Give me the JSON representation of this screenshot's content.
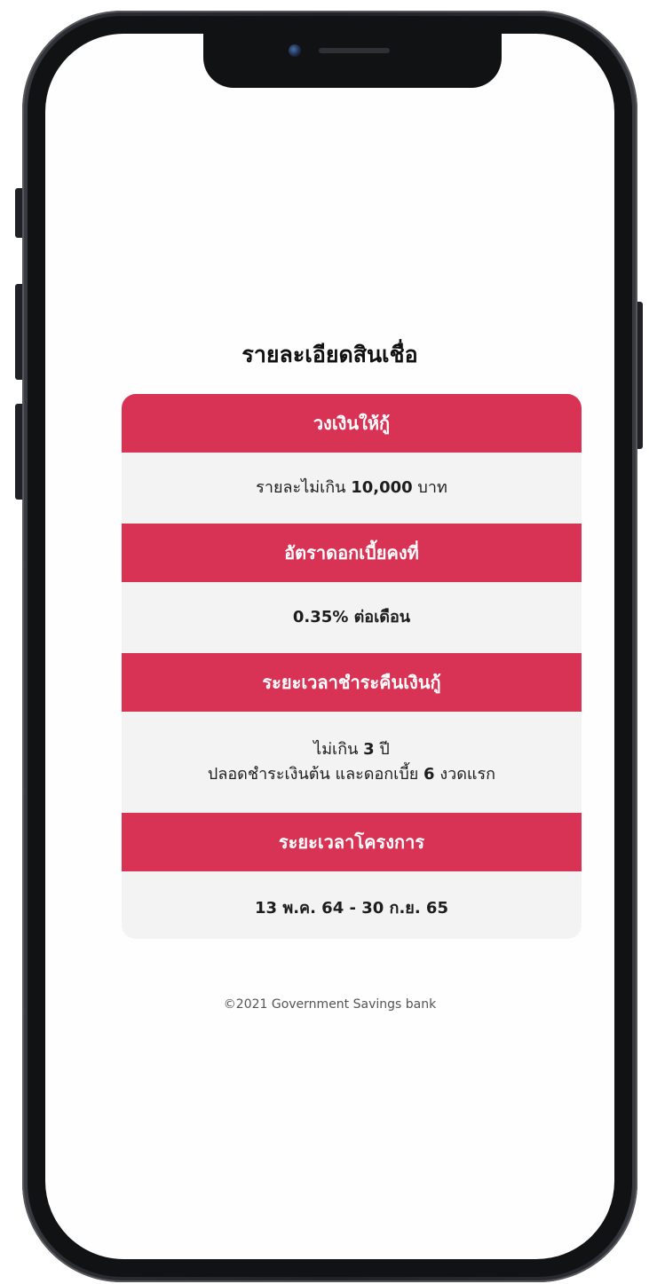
{
  "page": {
    "title": "รายละเอียดสินเชื่อ",
    "footer": "©2021 Government Savings bank"
  },
  "sections": [
    {
      "header": "วงเงินให้กู้",
      "body_prefix": "รายละไม่เกิน",
      "body_bold": "10,000",
      "body_suffix": "บาท"
    },
    {
      "header": "อัตราดอกเบี้ยคงที่",
      "body": "0.35% ต่อเดือน"
    },
    {
      "header": "ระยะเวลาชำระคืนเงินกู้",
      "line1_prefix": "ไม่เกิน",
      "line1_bold": "3",
      "line1_suffix": "ปี",
      "line2_prefix": "ปลอดชำระเงินต้น และดอกเบี้ย",
      "line2_bold": "6",
      "line2_suffix": "งวดแรก"
    },
    {
      "header": "ระยะเวลาโครงการ",
      "body": "13 พ.ค. 64 - 30 ก.ย. 65"
    }
  ],
  "colors": {
    "accent": "#d83355",
    "body_bg": "#f3f3f3",
    "device_frame": "#202227"
  },
  "icons": {
    "camera": "front-camera-icon",
    "speaker": "earpiece-speaker-icon"
  }
}
